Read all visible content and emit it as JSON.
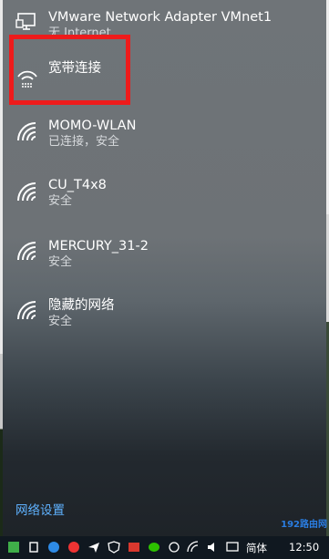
{
  "networks": [
    {
      "name": "VMware Network Adapter VMnet1",
      "status": "无 Internet",
      "icon": "ethernet-monitor-icon"
    },
    {
      "name": "宽带连接",
      "status": "",
      "icon": "dialup-icon"
    },
    {
      "name": "MOMO-WLAN",
      "status": "已连接，安全",
      "icon": "wifi-icon"
    },
    {
      "name": "CU_T4x8",
      "status": "安全",
      "icon": "wifi-icon"
    },
    {
      "name": "MERCURY_31-2",
      "status": "安全",
      "icon": "wifi-icon"
    },
    {
      "name": "隐藏的网络",
      "status": "安全",
      "icon": "wifi-icon"
    }
  ],
  "settings_link": "网络设置",
  "taskbar": {
    "ime": "简体",
    "time": "12:50"
  },
  "watermark": "192路由网",
  "colors": {
    "highlight": "#ee1b1b",
    "link": "#5fb2ff",
    "taskbar": "#101820"
  }
}
